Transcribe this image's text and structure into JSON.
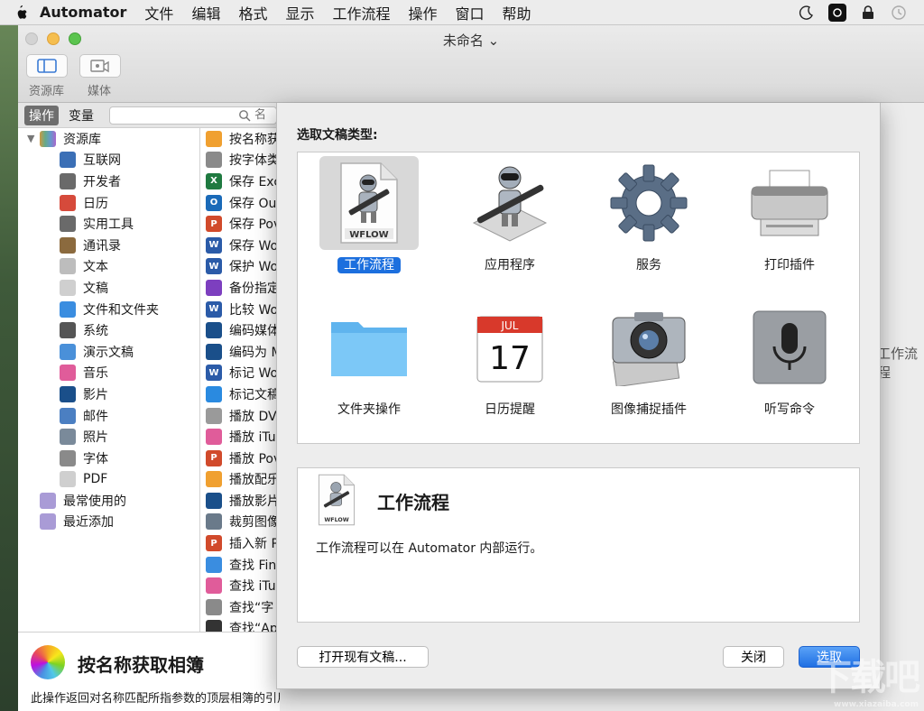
{
  "menubar": {
    "app_name": "Automator",
    "items": [
      "文件",
      "编辑",
      "格式",
      "显示",
      "工作流程",
      "操作",
      "窗口",
      "帮助"
    ]
  },
  "window": {
    "title": "未命名 ⌄",
    "toolbar": {
      "library_label": "资源库",
      "media_label": "媒体"
    }
  },
  "library": {
    "tab_actions": "操作",
    "tab_variables": "变量",
    "search_placeholder": "名",
    "root": "资源库",
    "items": [
      {
        "label": "互联网",
        "icon": "globe-icon",
        "color": "#3b6fb6"
      },
      {
        "label": "开发者",
        "icon": "tools-icon",
        "color": "#6a6a6a"
      },
      {
        "label": "日历",
        "icon": "calendar-icon",
        "color": "#d64a3b"
      },
      {
        "label": "实用工具",
        "icon": "tools-icon",
        "color": "#6a6a6a"
      },
      {
        "label": "通讯录",
        "icon": "contacts-icon",
        "color": "#8b6a3e"
      },
      {
        "label": "文本",
        "icon": "text-icon",
        "color": "#bdbdbd"
      },
      {
        "label": "文稿",
        "icon": "document-icon",
        "color": "#cfcfcf"
      },
      {
        "label": "文件和文件夹",
        "icon": "finder-icon",
        "color": "#3a8de0"
      },
      {
        "label": "系统",
        "icon": "system-icon",
        "color": "#555555"
      },
      {
        "label": "演示文稿",
        "icon": "keynote-icon",
        "color": "#4a90d9"
      },
      {
        "label": "音乐",
        "icon": "music-icon",
        "color": "#e05c9a"
      },
      {
        "label": "影片",
        "icon": "quicktime-icon",
        "color": "#1a4f8a"
      },
      {
        "label": "邮件",
        "icon": "mail-icon",
        "color": "#4b7fc2"
      },
      {
        "label": "照片",
        "icon": "photos-icon",
        "color": "#7a8a9a"
      },
      {
        "label": "字体",
        "icon": "font-icon",
        "color": "#8a8a8a"
      },
      {
        "label": "PDF",
        "icon": "pdf-icon",
        "color": "#cfcfcf"
      }
    ],
    "smart_groups": [
      {
        "label": "最常使用的",
        "icon": "folder-icon"
      },
      {
        "label": "最近添加",
        "icon": "folder-icon"
      }
    ]
  },
  "actions": [
    {
      "label": "按名称获",
      "icon": "photos-icon",
      "color": "#f0a030",
      "t": ""
    },
    {
      "label": "按字体类",
      "icon": "font-icon",
      "color": "#8a8a8a",
      "t": ""
    },
    {
      "label": "保存 Exc",
      "icon": "excel-icon",
      "color": "#1f7a40",
      "t": "X"
    },
    {
      "label": "保存 Ou",
      "icon": "outlook-icon",
      "color": "#1a6ab8",
      "t": "O"
    },
    {
      "label": "保存 Pov",
      "icon": "powerpoint-icon",
      "color": "#d14a2b",
      "t": "P"
    },
    {
      "label": "保存 Wo",
      "icon": "word-icon",
      "color": "#2b5ba8",
      "t": "W"
    },
    {
      "label": "保护 Wo",
      "icon": "word-icon",
      "color": "#2b5ba8",
      "t": "W"
    },
    {
      "label": "备份指定",
      "icon": "backup-icon",
      "color": "#7d3fbf",
      "t": ""
    },
    {
      "label": "比较 Wo",
      "icon": "word-icon",
      "color": "#2b5ba8",
      "t": "W"
    },
    {
      "label": "编码媒体",
      "icon": "quicktime-icon",
      "color": "#1a4f8a",
      "t": ""
    },
    {
      "label": "编码为 M",
      "icon": "quicktime-icon",
      "color": "#1a4f8a",
      "t": ""
    },
    {
      "label": "标记 Wo",
      "icon": "word-icon",
      "color": "#2b5ba8",
      "t": "W"
    },
    {
      "label": "标记文稿",
      "icon": "safari-icon",
      "color": "#2a8ae0",
      "t": ""
    },
    {
      "label": "播放 DV",
      "icon": "dvd-icon",
      "color": "#9a9a9a",
      "t": ""
    },
    {
      "label": "播放 iTu",
      "icon": "music-icon",
      "color": "#e05c9a",
      "t": ""
    },
    {
      "label": "播放 Pov",
      "icon": "powerpoint-icon",
      "color": "#d14a2b",
      "t": "P"
    },
    {
      "label": "播放配乐",
      "icon": "photos-icon",
      "color": "#f0a030",
      "t": ""
    },
    {
      "label": "播放影片",
      "icon": "quicktime-icon",
      "color": "#1a4f8a",
      "t": ""
    },
    {
      "label": "裁剪图像",
      "icon": "preview-icon",
      "color": "#6a7a8a",
      "t": ""
    },
    {
      "label": "插入新 P",
      "icon": "powerpoint-icon",
      "color": "#d14a2b",
      "t": "P"
    },
    {
      "label": "查找 Fin",
      "icon": "finder-icon",
      "color": "#3a8de0",
      "t": ""
    },
    {
      "label": "查找 iTu",
      "icon": "music-icon",
      "color": "#e05c9a",
      "t": ""
    },
    {
      "label": "查找“字",
      "icon": "font-icon",
      "color": "#8a8a8a",
      "t": ""
    },
    {
      "label": "查找“Ap",
      "icon": "aperture-icon",
      "color": "#333333",
      "t": ""
    }
  ],
  "description": {
    "title": "按名称获取相簿",
    "text": "此操作返回对名称匹配所指参数的顶层相簿的引用。"
  },
  "right_peek": "工作流程",
  "sheet": {
    "heading": "选取文稿类型:",
    "types": [
      {
        "label": "工作流程",
        "icon": "workflow-icon",
        "selected": true
      },
      {
        "label": "应用程序",
        "icon": "automator-robot-icon",
        "selected": false
      },
      {
        "label": "服务",
        "icon": "gear-icon",
        "selected": false
      },
      {
        "label": "打印插件",
        "icon": "printer-icon",
        "selected": false
      },
      {
        "label": "文件夹操作",
        "icon": "folder-icon",
        "selected": false
      },
      {
        "label": "日历提醒",
        "icon": "calendar-icon",
        "selected": false
      },
      {
        "label": "图像捕捉插件",
        "icon": "camera-icon",
        "selected": false
      },
      {
        "label": "听写命令",
        "icon": "microphone-icon",
        "selected": false
      }
    ],
    "wflow_badge": "WFLOW",
    "calendar_month": "JUL",
    "calendar_day": "17",
    "info_title": "工作流程",
    "info_text": "工作流程可以在 Automator 内部运行。",
    "btn_open": "打开现有文稿...",
    "btn_close": "关闭",
    "btn_choose": "选取"
  },
  "watermark": {
    "main": "下载吧",
    "sub": "www.xiazaiba.com"
  }
}
